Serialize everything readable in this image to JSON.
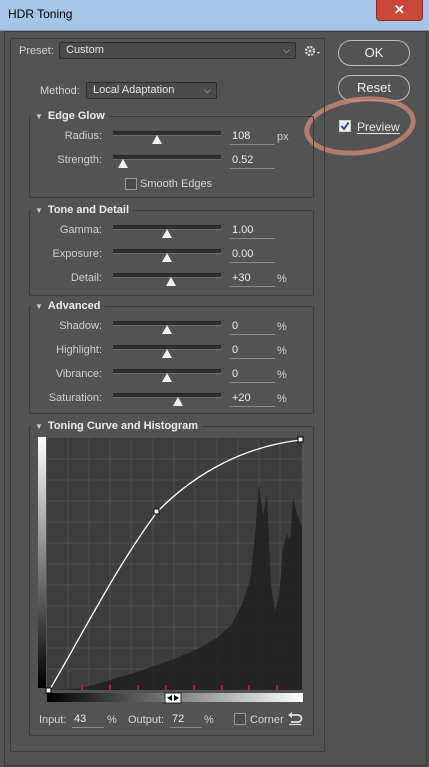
{
  "window": {
    "title": "HDR Toning",
    "close_glyph": "✕"
  },
  "preset": {
    "label": "Preset:",
    "value": "Custom",
    "gear_icon": "gear-icon"
  },
  "buttons": {
    "ok": "OK",
    "reset": "Reset"
  },
  "preview": {
    "label": "Preview",
    "checked": true
  },
  "method": {
    "label": "Method:",
    "value": "Local Adaptation"
  },
  "edge_glow": {
    "title": "Edge Glow",
    "radius": {
      "label": "Radius:",
      "value": "108",
      "unit": "px",
      "level": 0.41
    },
    "strength": {
      "label": "Strength:",
      "value": "0.52",
      "unit": "",
      "level": 0.09
    },
    "smooth_edges": {
      "label": "Smooth Edges",
      "checked": false
    }
  },
  "tone_detail": {
    "title": "Tone and Detail",
    "gamma": {
      "label": "Gamma:",
      "value": "1.00",
      "unit": "",
      "level": 0.5
    },
    "exposure": {
      "label": "Exposure:",
      "value": "0.00",
      "unit": "",
      "level": 0.5
    },
    "detail": {
      "label": "Detail:",
      "value": "+30",
      "unit": "%",
      "level": 0.54
    }
  },
  "advanced": {
    "title": "Advanced",
    "shadow": {
      "label": "Shadow:",
      "value": "0",
      "unit": "%",
      "level": 0.5
    },
    "highlight": {
      "label": "Highlight:",
      "value": "0",
      "unit": "%",
      "level": 0.5
    },
    "vibrance": {
      "label": "Vibrance:",
      "value": "0",
      "unit": "%",
      "level": 0.5
    },
    "saturation": {
      "label": "Saturation:",
      "value": "+20",
      "unit": "%",
      "level": 0.6
    }
  },
  "curve": {
    "title": "Toning Curve and Histogram",
    "input_label": "Input:",
    "input_value": "43",
    "input_unit": "%",
    "output_label": "Output:",
    "output_value": "72",
    "output_unit": "%",
    "corner_label": "Corner",
    "corner_checked": false,
    "reset_icon": "reset-curve-icon"
  }
}
